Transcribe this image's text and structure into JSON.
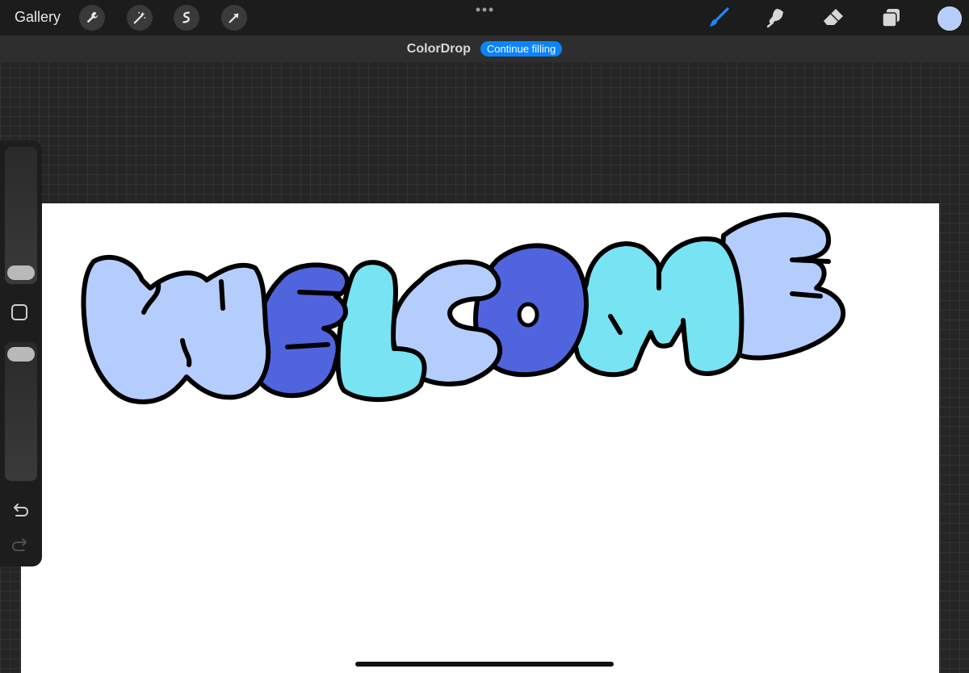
{
  "topbar": {
    "gallery_label": "Gallery",
    "left_tools": [
      "wrench-icon",
      "magic-wand-icon",
      "selection-icon",
      "transform-icon"
    ],
    "right_tools": [
      "brush-icon",
      "smudge-icon",
      "eraser-icon",
      "layers-icon"
    ],
    "active_tool": "brush-icon",
    "current_color": "#b5cdfd"
  },
  "notice": {
    "title": "ColorDrop",
    "button_label": "Continue filling",
    "button_color": "#0a84ff"
  },
  "artwork": {
    "description_word": "WELCOME",
    "colors": {
      "light_blue": "#b5cdfd",
      "royal_blue": "#5064de",
      "cyan": "#77e3f3",
      "outline": "#000000"
    }
  },
  "sidebar": {
    "brush_size_label": "",
    "opacity_label": ""
  }
}
